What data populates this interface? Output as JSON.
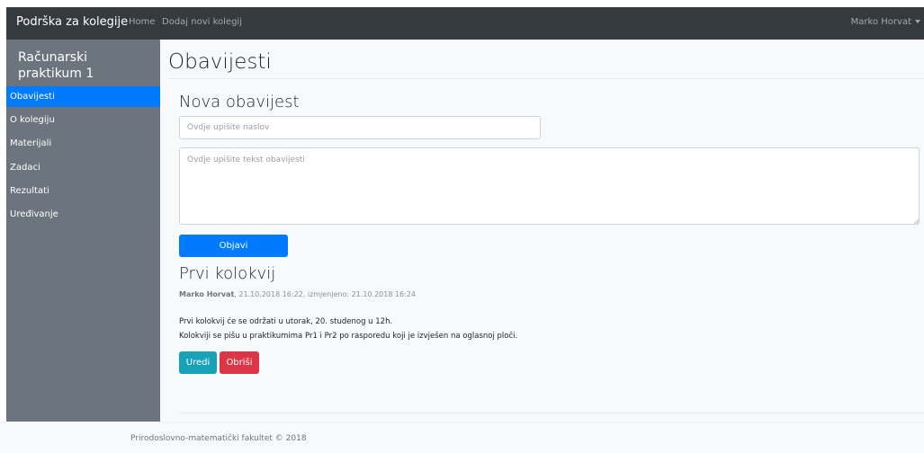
{
  "navbar": {
    "brand": "Podrška za kolegije",
    "links": [
      "Home",
      "Dodaj novi kolegij"
    ],
    "user": "Marko Horvat"
  },
  "sidebar": {
    "title": "Računarski praktikum 1",
    "items": [
      {
        "label": "Obavijesti",
        "active": true
      },
      {
        "label": "O kolegiju",
        "active": false
      },
      {
        "label": "Materijali",
        "active": false
      },
      {
        "label": "Zadaci",
        "active": false
      },
      {
        "label": "Rezultati",
        "active": false
      },
      {
        "label": "Uređivanje",
        "active": false
      }
    ]
  },
  "main": {
    "page_title": "Obavijesti",
    "new_notice": {
      "heading": "Nova obavijest",
      "title_placeholder": "Ovdje upišite naslov",
      "body_placeholder": "Ovdje upišite tekst obavijesti",
      "submit_label": "Objavi"
    },
    "notice": {
      "title": "Prvi kolokvij",
      "author": "Marko Horvat",
      "meta": ", 21.10.2018 16:22, izmjenjeno: 21.10.2018 16:24",
      "lines": [
        "Prvi kolokvij će se održati u utorak, 20. studenog u 12h.",
        "Kolokviji se pišu u praktikumima Pr1 i Pr2 po rasporedu koji je izvješen na oglasnoj ploči."
      ],
      "edit_label": "Uredi",
      "delete_label": "Obriši"
    }
  },
  "footer": {
    "text": "Prirodoslovno-matematički fakultet © 2018"
  },
  "colors": {
    "navbar": "#343a40",
    "sidebar": "#6c757d",
    "primary": "#007bff",
    "info": "#17a2b8",
    "danger": "#dc3545"
  },
  "icons": {
    "user_menu": "caret-down-icon",
    "textarea": "resize-grip-icon"
  }
}
